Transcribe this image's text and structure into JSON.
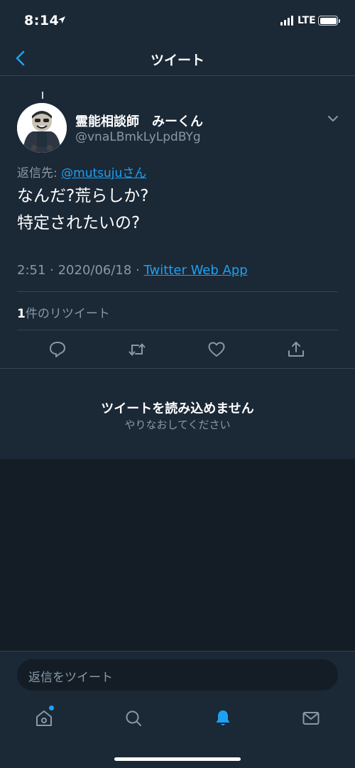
{
  "status_bar": {
    "time": "8:14",
    "network": "LTE"
  },
  "nav": {
    "title": "ツイート"
  },
  "tweet": {
    "author_name": "霊能相談師　みーくん",
    "author_handle": "@vnaLBmkLyLpdBYg",
    "reply_prefix": "返信先: ",
    "reply_to": "@mutsujuさん",
    "text_line1": "なんだ?荒らしか?",
    "text_line2": "特定されたいの?",
    "time": "2:51",
    "sep1": " · ",
    "date": "2020/06/18",
    "sep2": " · ",
    "source": "Twitter Web App",
    "retweet_count": "1",
    "retweet_label": "件のリツイート"
  },
  "error": {
    "title": "ツイートを読み込めません",
    "subtitle": "やりなおしてください"
  },
  "reply_bar": {
    "placeholder": "返信をツイート"
  },
  "tabs": [
    {
      "icon": "home-icon"
    },
    {
      "icon": "search-icon"
    },
    {
      "icon": "bell-icon",
      "active": true
    },
    {
      "icon": "mail-icon"
    }
  ],
  "colors": {
    "accent": "#1da1f2",
    "bg": "#141d26",
    "card": "#1b2836",
    "muted": "#8899a6",
    "divider": "#38444d"
  }
}
